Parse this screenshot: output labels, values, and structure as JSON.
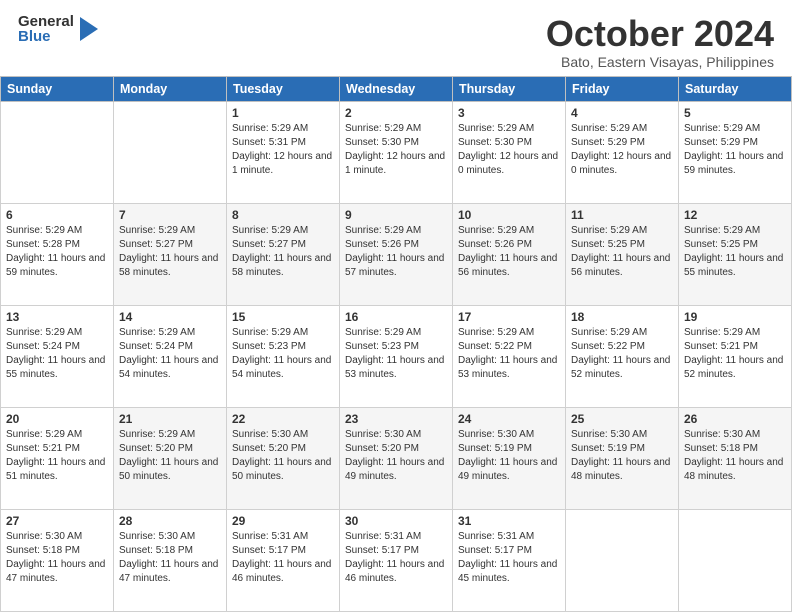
{
  "header": {
    "logo_general": "General",
    "logo_blue": "Blue",
    "month": "October 2024",
    "location": "Bato, Eastern Visayas, Philippines"
  },
  "days_of_week": [
    "Sunday",
    "Monday",
    "Tuesday",
    "Wednesday",
    "Thursday",
    "Friday",
    "Saturday"
  ],
  "weeks": [
    [
      {
        "day": "",
        "info": ""
      },
      {
        "day": "",
        "info": ""
      },
      {
        "day": "1",
        "info": "Sunrise: 5:29 AM\nSunset: 5:31 PM\nDaylight: 12 hours and 1 minute."
      },
      {
        "day": "2",
        "info": "Sunrise: 5:29 AM\nSunset: 5:30 PM\nDaylight: 12 hours and 1 minute."
      },
      {
        "day": "3",
        "info": "Sunrise: 5:29 AM\nSunset: 5:30 PM\nDaylight: 12 hours and 0 minutes."
      },
      {
        "day": "4",
        "info": "Sunrise: 5:29 AM\nSunset: 5:29 PM\nDaylight: 12 hours and 0 minutes."
      },
      {
        "day": "5",
        "info": "Sunrise: 5:29 AM\nSunset: 5:29 PM\nDaylight: 11 hours and 59 minutes."
      }
    ],
    [
      {
        "day": "6",
        "info": "Sunrise: 5:29 AM\nSunset: 5:28 PM\nDaylight: 11 hours and 59 minutes."
      },
      {
        "day": "7",
        "info": "Sunrise: 5:29 AM\nSunset: 5:27 PM\nDaylight: 11 hours and 58 minutes."
      },
      {
        "day": "8",
        "info": "Sunrise: 5:29 AM\nSunset: 5:27 PM\nDaylight: 11 hours and 58 minutes."
      },
      {
        "day": "9",
        "info": "Sunrise: 5:29 AM\nSunset: 5:26 PM\nDaylight: 11 hours and 57 minutes."
      },
      {
        "day": "10",
        "info": "Sunrise: 5:29 AM\nSunset: 5:26 PM\nDaylight: 11 hours and 56 minutes."
      },
      {
        "day": "11",
        "info": "Sunrise: 5:29 AM\nSunset: 5:25 PM\nDaylight: 11 hours and 56 minutes."
      },
      {
        "day": "12",
        "info": "Sunrise: 5:29 AM\nSunset: 5:25 PM\nDaylight: 11 hours and 55 minutes."
      }
    ],
    [
      {
        "day": "13",
        "info": "Sunrise: 5:29 AM\nSunset: 5:24 PM\nDaylight: 11 hours and 55 minutes."
      },
      {
        "day": "14",
        "info": "Sunrise: 5:29 AM\nSunset: 5:24 PM\nDaylight: 11 hours and 54 minutes."
      },
      {
        "day": "15",
        "info": "Sunrise: 5:29 AM\nSunset: 5:23 PM\nDaylight: 11 hours and 54 minutes."
      },
      {
        "day": "16",
        "info": "Sunrise: 5:29 AM\nSunset: 5:23 PM\nDaylight: 11 hours and 53 minutes."
      },
      {
        "day": "17",
        "info": "Sunrise: 5:29 AM\nSunset: 5:22 PM\nDaylight: 11 hours and 53 minutes."
      },
      {
        "day": "18",
        "info": "Sunrise: 5:29 AM\nSunset: 5:22 PM\nDaylight: 11 hours and 52 minutes."
      },
      {
        "day": "19",
        "info": "Sunrise: 5:29 AM\nSunset: 5:21 PM\nDaylight: 11 hours and 52 minutes."
      }
    ],
    [
      {
        "day": "20",
        "info": "Sunrise: 5:29 AM\nSunset: 5:21 PM\nDaylight: 11 hours and 51 minutes."
      },
      {
        "day": "21",
        "info": "Sunrise: 5:29 AM\nSunset: 5:20 PM\nDaylight: 11 hours and 50 minutes."
      },
      {
        "day": "22",
        "info": "Sunrise: 5:30 AM\nSunset: 5:20 PM\nDaylight: 11 hours and 50 minutes."
      },
      {
        "day": "23",
        "info": "Sunrise: 5:30 AM\nSunset: 5:20 PM\nDaylight: 11 hours and 49 minutes."
      },
      {
        "day": "24",
        "info": "Sunrise: 5:30 AM\nSunset: 5:19 PM\nDaylight: 11 hours and 49 minutes."
      },
      {
        "day": "25",
        "info": "Sunrise: 5:30 AM\nSunset: 5:19 PM\nDaylight: 11 hours and 48 minutes."
      },
      {
        "day": "26",
        "info": "Sunrise: 5:30 AM\nSunset: 5:18 PM\nDaylight: 11 hours and 48 minutes."
      }
    ],
    [
      {
        "day": "27",
        "info": "Sunrise: 5:30 AM\nSunset: 5:18 PM\nDaylight: 11 hours and 47 minutes."
      },
      {
        "day": "28",
        "info": "Sunrise: 5:30 AM\nSunset: 5:18 PM\nDaylight: 11 hours and 47 minutes."
      },
      {
        "day": "29",
        "info": "Sunrise: 5:31 AM\nSunset: 5:17 PM\nDaylight: 11 hours and 46 minutes."
      },
      {
        "day": "30",
        "info": "Sunrise: 5:31 AM\nSunset: 5:17 PM\nDaylight: 11 hours and 46 minutes."
      },
      {
        "day": "31",
        "info": "Sunrise: 5:31 AM\nSunset: 5:17 PM\nDaylight: 11 hours and 45 minutes."
      },
      {
        "day": "",
        "info": ""
      },
      {
        "day": "",
        "info": ""
      }
    ]
  ]
}
